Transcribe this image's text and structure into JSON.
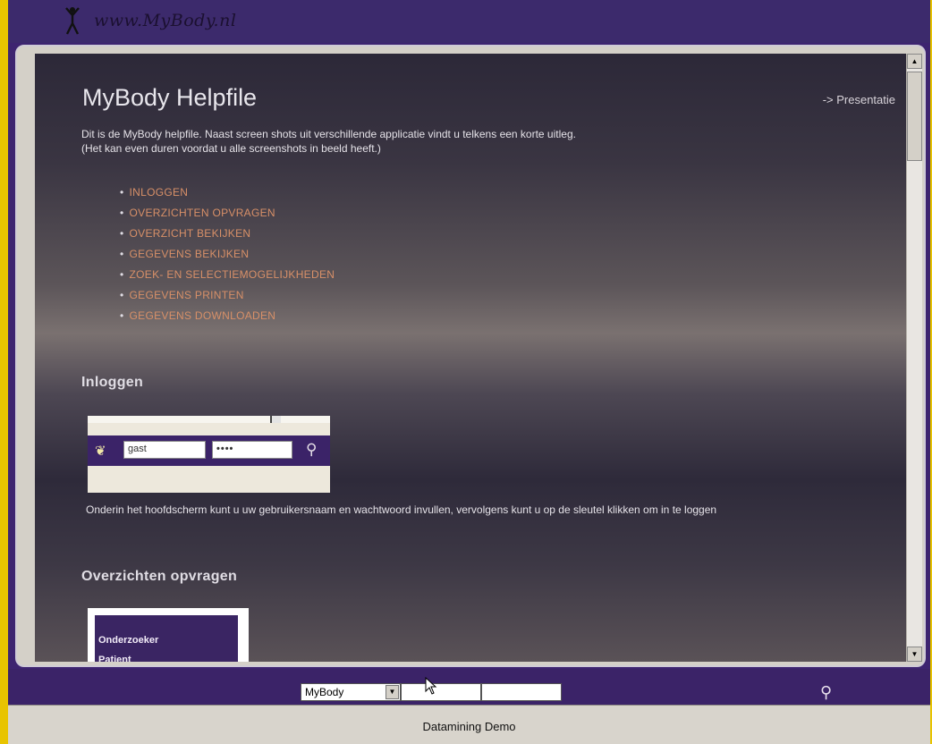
{
  "header": {
    "logo_text": "www.MyBody.nl"
  },
  "content": {
    "title": "MyBody Helpfile",
    "presentatie_link": "-> Presentatie",
    "intro_line1": "Dit is de MyBody helpfile. Naast screen shots uit verschillende applicatie vindt u telkens een korte uitleg.",
    "intro_line2": "(Het kan even duren voordat u alle screenshots in beeld heeft.)",
    "toc": [
      "INLOGGEN",
      "OVERZICHTEN OPVRAGEN",
      "OVERZICHT BEKIJKEN",
      "GEGEVENS BEKIJKEN",
      "ZOEK- EN SELECTIEMOGELIJKHEDEN",
      "GEGEVENS PRINTEN",
      "GEGEVENS DOWNLOADEN"
    ],
    "section_login": "Inloggen",
    "login_shot": {
      "username": "gast",
      "password": "••••"
    },
    "login_caption": "Onderin het hoofdscherm kunt u uw gebruikersnaam en wachtwoord invullen, vervolgens kunt u op de sleutel klikken om in te loggen",
    "section_overview": "Overzichten opvragen",
    "overview_shot": {
      "item1": "Onderzoeker",
      "item2": "Patient"
    }
  },
  "bottombar": {
    "select_value": "MyBody",
    "username_value": "",
    "password_value": ""
  },
  "status": {
    "text": "Datamining Demo"
  },
  "icons": {
    "logo": "figure-icon",
    "key": "key-icon",
    "dropdown": "chevron-down-icon"
  },
  "colors": {
    "frame_purple": "#3b2368",
    "outer_yellow": "#e8c400",
    "link_orange": "#d89068"
  }
}
